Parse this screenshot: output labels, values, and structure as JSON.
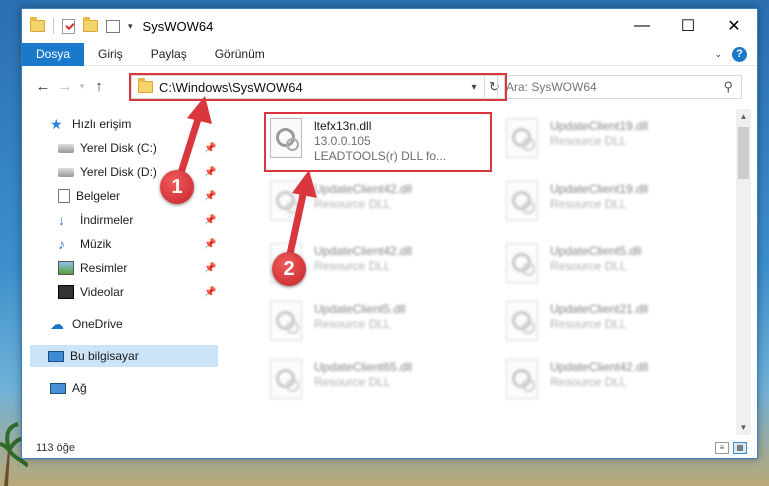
{
  "window": {
    "title": "SysWOW64",
    "controls": {
      "minimize": "—",
      "maximize": "☐",
      "close": "✕"
    }
  },
  "ribbon": {
    "tabs": [
      "Dosya",
      "Giriş",
      "Paylaş",
      "Görünüm"
    ],
    "active_tab": "Dosya",
    "help_label": "?"
  },
  "address": {
    "path": "C:\\Windows\\SysWOW64",
    "search_placeholder": "Ara: SysWOW64"
  },
  "sidebar": {
    "items": [
      {
        "label": "Hızlı erişim",
        "icon": "star-icon",
        "pinned": false
      },
      {
        "label": "Yerel Disk (C:)",
        "icon": "drive-icon",
        "pinned": true
      },
      {
        "label": "Yerel Disk (D:)",
        "icon": "drive-icon",
        "pinned": true
      },
      {
        "label": "Belgeler",
        "icon": "document-icon",
        "pinned": true
      },
      {
        "label": "İndirmeler",
        "icon": "download-icon",
        "pinned": true
      },
      {
        "label": "Müzik",
        "icon": "music-icon",
        "pinned": true
      },
      {
        "label": "Resimler",
        "icon": "pictures-icon",
        "pinned": true
      },
      {
        "label": "Videolar",
        "icon": "videos-icon",
        "pinned": true
      },
      {
        "label": "OneDrive",
        "icon": "cloud-icon",
        "pinned": false
      },
      {
        "label": "Bu bilgisayar",
        "icon": "computer-icon",
        "pinned": false,
        "selected": true
      },
      {
        "label": "Ağ",
        "icon": "network-icon",
        "pinned": false
      }
    ]
  },
  "files": [
    {
      "name": "ltefx13n.dll",
      "line2": "13.0.0.105",
      "line3": "LEADTOOLS(r) DLL fo...",
      "highlighted": true
    },
    {
      "name": "UpdateClient19.dll",
      "line2": "Resource DLL",
      "line3": ""
    },
    {
      "name": "UpdateClient42.dll",
      "line2": "Resource DLL",
      "line3": ""
    },
    {
      "name": "UpdateClient19.dll",
      "line2": "Resource DLL",
      "line3": ""
    },
    {
      "name": "UpdateClient42.dll",
      "line2": "Resource DLL",
      "line3": ""
    },
    {
      "name": "UpdateClient5.dll",
      "line2": "Resource DLL",
      "line3": ""
    },
    {
      "name": "UpdateClient5.dll",
      "line2": "Resource DLL",
      "line3": ""
    },
    {
      "name": "UpdateClient21.dll",
      "line2": "Resource DLL",
      "line3": ""
    },
    {
      "name": "UpdateClient65.dll",
      "line2": "Resource DLL",
      "line3": ""
    },
    {
      "name": "UpdateClient42.dll",
      "line2": "Resource DLL",
      "line3": ""
    }
  ],
  "status": {
    "item_count": "113 öğe"
  },
  "annotations": {
    "badge1": "1",
    "badge2": "2",
    "color": "#d9373d"
  }
}
